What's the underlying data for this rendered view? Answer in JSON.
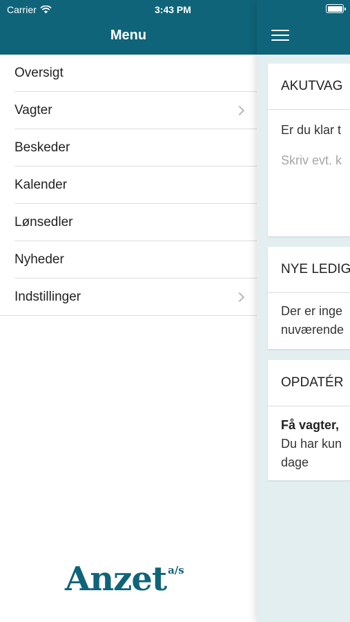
{
  "status_bar": {
    "carrier": "Carrier",
    "time": "3:43 PM"
  },
  "menu": {
    "title": "Menu",
    "items": [
      {
        "label": "Oversigt",
        "chevron": false
      },
      {
        "label": "Vagter",
        "chevron": true
      },
      {
        "label": "Beskeder",
        "chevron": false
      },
      {
        "label": "Kalender",
        "chevron": false
      },
      {
        "label": "Lønsedler",
        "chevron": false
      },
      {
        "label": "Nyheder",
        "chevron": false
      },
      {
        "label": "Indstillinger",
        "chevron": true
      }
    ],
    "logo": {
      "text": "Anzet",
      "suffix": "a/s"
    }
  },
  "main": {
    "cards": [
      {
        "title": "AKUTVAG",
        "line1": "Er du klar t",
        "placeholder": "Skriv evt. k"
      },
      {
        "title": "NYE LEDIG",
        "line1": "Der er inge",
        "line2": "nuværende"
      },
      {
        "title": "OPDATÉR",
        "line1_bold": "Få vagter,",
        "line2": "Du har kun",
        "line3": "dage"
      }
    ]
  },
  "colors": {
    "brand": "#0f6479",
    "background": "#e3eef0"
  }
}
